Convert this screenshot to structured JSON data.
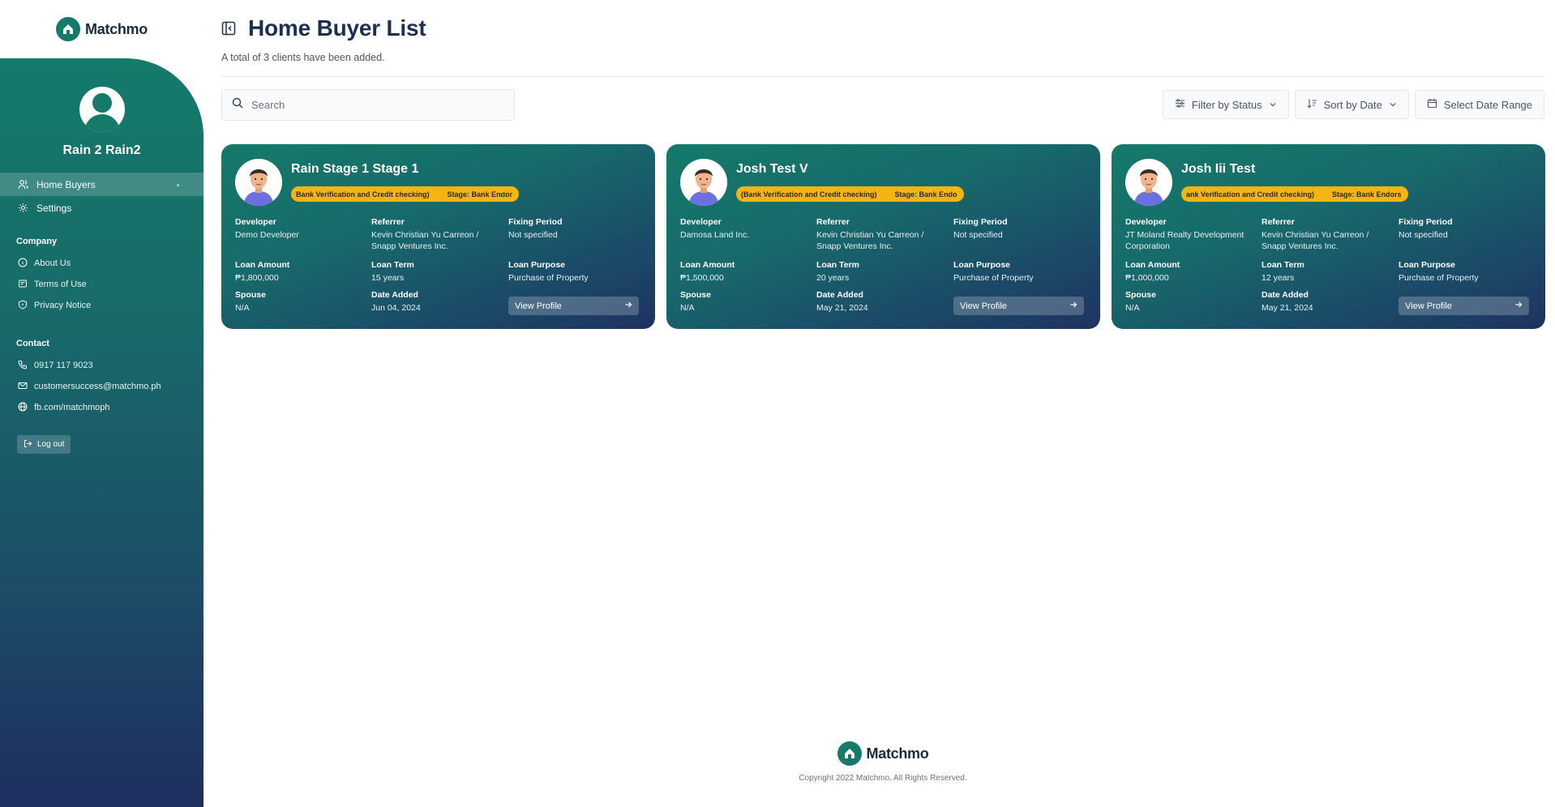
{
  "app": {
    "brand": "Matchmo"
  },
  "sidebar": {
    "user_name": "Rain 2 Rain2",
    "nav": [
      {
        "label": "Home Buyers",
        "icon": "users-icon",
        "active": true
      },
      {
        "label": "Settings",
        "icon": "gear-icon",
        "active": false
      }
    ],
    "company_title": "Company",
    "company_links": [
      {
        "label": "About Us",
        "icon": "info-icon"
      },
      {
        "label": "Terms of Use",
        "icon": "document-icon"
      },
      {
        "label": "Privacy Notice",
        "icon": "shield-icon"
      }
    ],
    "contact_title": "Contact",
    "contacts": [
      {
        "label": "0917 117 9023",
        "icon": "phone-icon"
      },
      {
        "label": "customersuccess@matchmo.ph",
        "icon": "mail-icon"
      },
      {
        "label": "fb.com/matchmoph",
        "icon": "globe-icon"
      }
    ],
    "logout_label": "Log out"
  },
  "header": {
    "title": "Home Buyer List",
    "subtitle": "A total of 3 clients have been added."
  },
  "search": {
    "placeholder": "Search",
    "value": ""
  },
  "toolbar": {
    "filter_label": "Filter by Status",
    "sort_label": "Sort by Date",
    "date_range_label": "Select Date Range"
  },
  "labels": {
    "developer": "Developer",
    "referrer": "Referrer",
    "fixing_period": "Fixing Period",
    "loan_amount": "Loan Amount",
    "loan_term": "Loan Term",
    "loan_purpose": "Loan Purpose",
    "spouse": "Spouse",
    "date_added": "Date Added",
    "view_profile": "View Profile"
  },
  "clients": [
    {
      "name": "Rain Stage 1 Stage 1",
      "status_tag": "Bank Verification and Credit checking)",
      "stage_tag": "Stage: Bank Endor",
      "developer": "Demo Developer",
      "referrer": "Kevin Christian Yu Carreon / Snapp Ventures Inc.",
      "fixing_period": "Not specified",
      "loan_amount": "₱1,800,000",
      "loan_term": "15 years",
      "loan_purpose": "Purchase of Property",
      "spouse": "N/A",
      "date_added": "Jun 04, 2024"
    },
    {
      "name": "Josh Test V",
      "status_tag": "(Bank Verification and Credit checking)",
      "stage_tag": "Stage: Bank Endo",
      "developer": "Damosa Land Inc.",
      "referrer": "Kevin Christian Yu Carreon / Snapp Ventures Inc.",
      "fixing_period": "Not specified",
      "loan_amount": "₱1,500,000",
      "loan_term": "20 years",
      "loan_purpose": "Purchase of Property",
      "spouse": "N/A",
      "date_added": "May 21, 2024"
    },
    {
      "name": "Josh Iii Test",
      "status_tag": "ank Verification and Credit checking)",
      "stage_tag": "Stage: Bank Endors",
      "developer": "JT Moland Realty Development Corporation",
      "referrer": "Kevin Christian Yu Carreon / Snapp Ventures Inc.",
      "fixing_period": "Not specified",
      "loan_amount": "₱1,000,000",
      "loan_term": "12 years",
      "loan_purpose": "Purchase of Property",
      "spouse": "N/A",
      "date_added": "May 21, 2024"
    }
  ],
  "footer": {
    "brand": "Matchmo",
    "copyright": "Copyright 2022 Matchmo. All Rights Reserved."
  },
  "colors": {
    "accent": "#147a6a",
    "navy": "#1e2e5f",
    "tag": "#f5b412",
    "title": "#1c2f4f"
  }
}
